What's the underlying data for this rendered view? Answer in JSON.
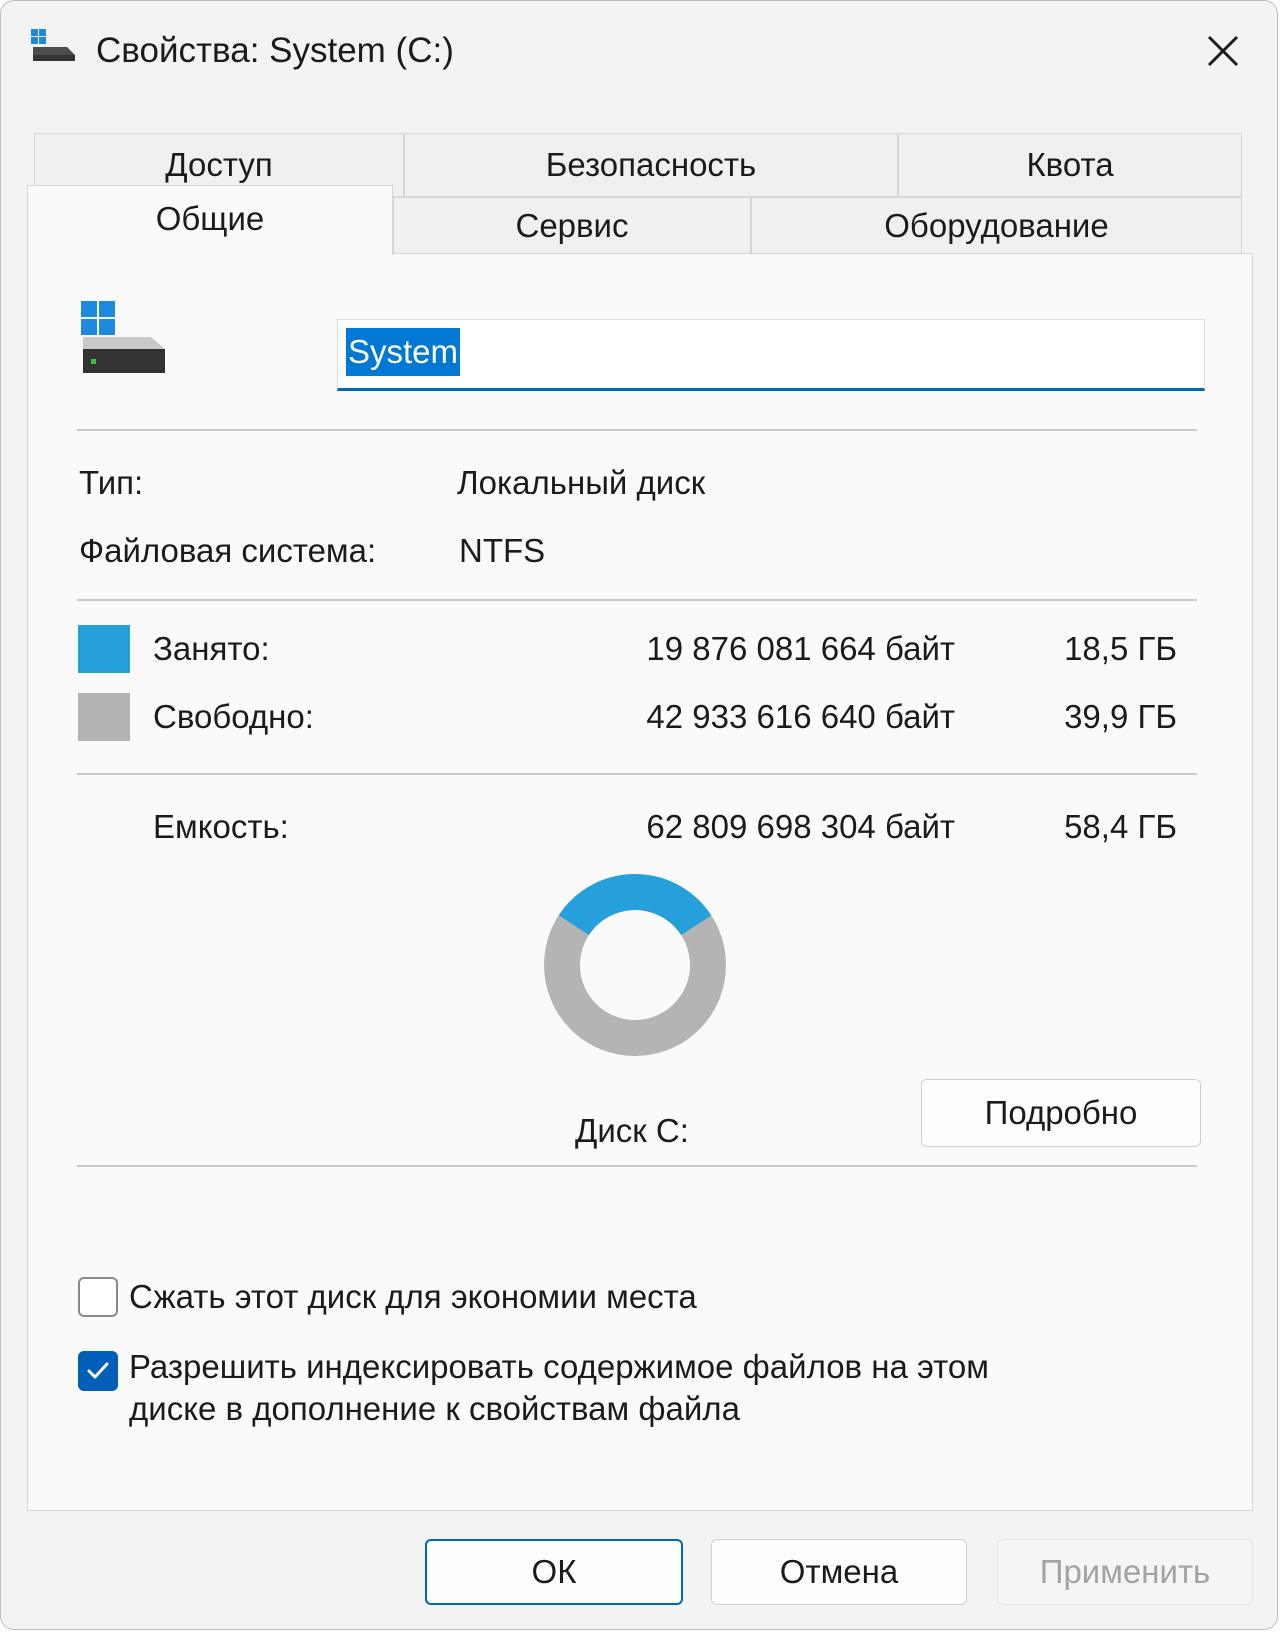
{
  "window": {
    "title": "Свойства: System (C:)"
  },
  "tabs": {
    "row_back": [
      "Доступ",
      "Безопасность",
      "Квота"
    ],
    "row_front": [
      "Общие",
      "Сервис",
      "Оборудование"
    ],
    "active": "Общие"
  },
  "general": {
    "volume_name": "System",
    "type_label": "Тип:",
    "type_value": "Локальный диск",
    "fs_label": "Файловая система:",
    "fs_value": "NTFS",
    "used": {
      "label": "Занято:",
      "bytes": "19 876 081 664 байт",
      "size": "18,5 ГБ",
      "color": "#26a0da"
    },
    "free": {
      "label": "Свободно:",
      "bytes": "42 933 616 640 байт",
      "size": "39,9 ГБ",
      "color": "#b4b4b4"
    },
    "capacity": {
      "label": "Емкость:",
      "bytes": "62 809 698 304 байт",
      "size": "58,4 ГБ"
    },
    "used_fraction": 0.3165,
    "disk_label": "Диск C:",
    "details_button": "Подробно",
    "compress_checkbox": {
      "label": "Сжать этот диск для экономии места",
      "checked": false
    },
    "index_checkbox": {
      "label_line1": "Разрешить индексировать содержимое файлов на этом",
      "label_line2": "диске в дополнение к свойствам файла",
      "checked": true
    }
  },
  "footer": {
    "ok": "ОК",
    "cancel": "Отмена",
    "apply": "Применить"
  },
  "colors": {
    "accent": "#0078d4",
    "used": "#26a0da",
    "free": "#b4b4b4"
  }
}
